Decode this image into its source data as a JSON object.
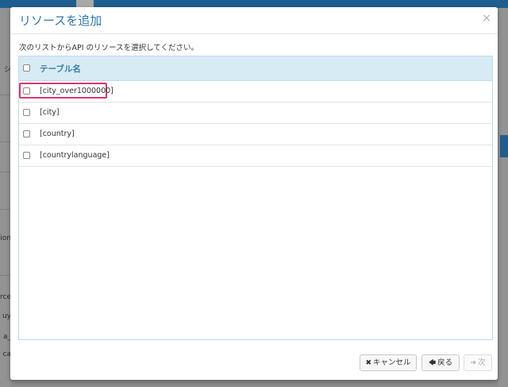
{
  "background": {
    "left_fragments": [
      "シ",
      "tion",
      "rce",
      "uy",
      "_a",
      "ca"
    ]
  },
  "modal": {
    "title": "リソースを追加",
    "close_glyph": "×",
    "instruction": "次のリストからAPI のリソースを選択してください。",
    "table": {
      "header_label": "テーブル名",
      "rows": [
        {
          "label": "[city_over1000000]",
          "highlighted": true
        },
        {
          "label": "[city]"
        },
        {
          "label": "[country]"
        },
        {
          "label": "[countrylanguage]"
        }
      ]
    },
    "buttons": {
      "cancel_icon": "✖",
      "cancel_label": "キャンセル",
      "back_icon": "🡄",
      "back_label": "戻る",
      "next_icon": "➔",
      "next_label": "次"
    }
  },
  "colors": {
    "accent": "#2e78b3",
    "header_bg": "#d7ebf5",
    "highlight": "#e0336e"
  }
}
